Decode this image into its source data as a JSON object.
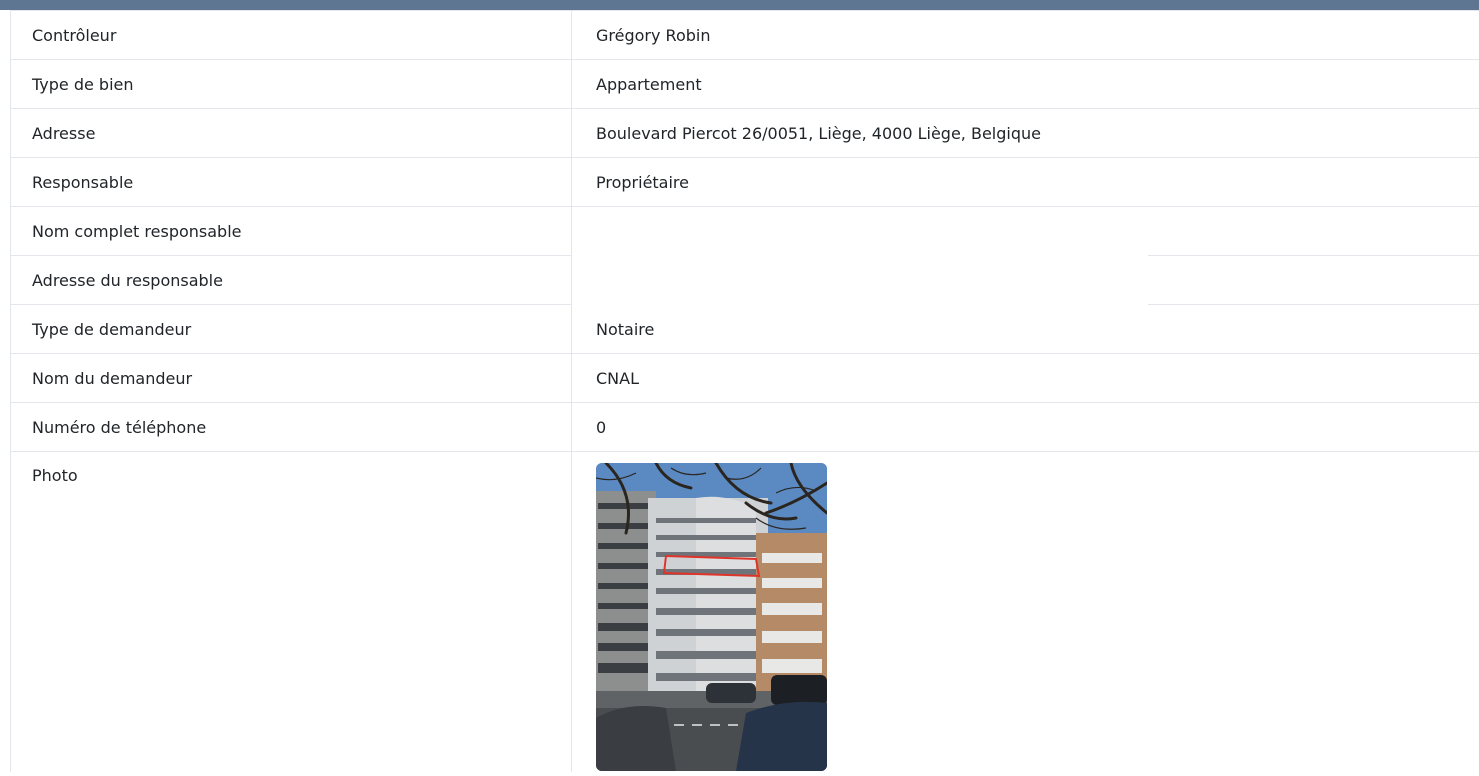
{
  "rows": [
    {
      "label": "Contrôleur",
      "value": "Grégory Robin"
    },
    {
      "label": "Type de bien",
      "value": "Appartement"
    },
    {
      "label": "Adresse",
      "value": "Boulevard Piercot 26/0051, Liège, 4000 Liège, Belgique"
    },
    {
      "label": "Responsable",
      "value": "Propriétaire"
    },
    {
      "label": "Nom complet responsable",
      "value": ""
    },
    {
      "label": "Adresse du responsable",
      "value": ""
    },
    {
      "label": "Type de demandeur",
      "value": "Notaire"
    },
    {
      "label": "Nom du demandeur",
      "value": "CNAL"
    },
    {
      "label": "Numéro de téléphone",
      "value": "0"
    }
  ],
  "photo_row": {
    "label": "Photo",
    "image": "building-photo"
  },
  "colors": {
    "header_bar": "#5f7692",
    "border": "#e3e6ea",
    "text": "#212529",
    "highlight": "#e0342b"
  }
}
